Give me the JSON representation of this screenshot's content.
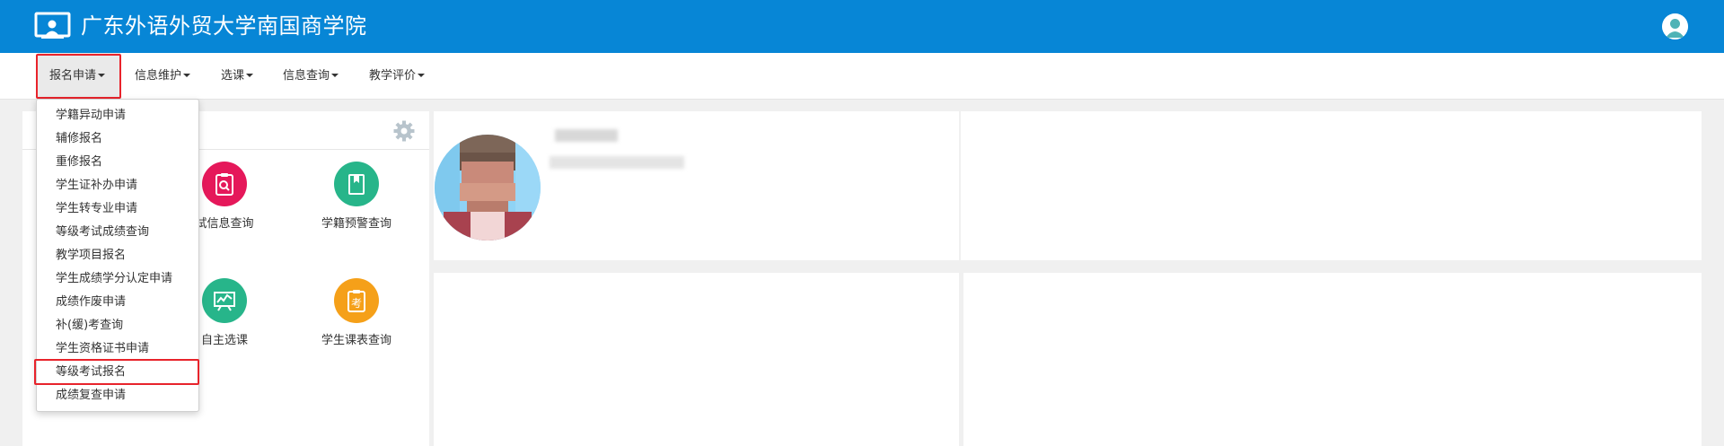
{
  "header": {
    "school_name": "广东外语外贸大学南国商学院",
    "logo_icon": "presentation-screen-icon",
    "avatar_icon": "user-avatar-icon",
    "background_color": "#0786d6"
  },
  "nav": {
    "items": [
      {
        "label": "报名申请",
        "active": true
      },
      {
        "label": "信息维护"
      },
      {
        "label": "选课"
      },
      {
        "label": "信息查询"
      },
      {
        "label": "教学评价"
      }
    ]
  },
  "dropdown": {
    "items": [
      "学籍异动申请",
      "辅修报名",
      "重修报名",
      "学生证补办申请",
      "学生转专业申请",
      "等级考试成绩查询",
      "教学项目报名",
      "学生成绩学分认定申请",
      "成绩作废申请",
      "补(缓)考查询",
      "学生资格证书申请",
      "等级考试报名",
      "成绩复查申请"
    ],
    "highlighted_item": "等级考试报名"
  },
  "apps": {
    "settings_icon": "gear-icon",
    "tiles": [
      {
        "label": "试信息查询",
        "icon": "clipboard-search-icon",
        "color": "#e5185a"
      },
      {
        "label": "学籍预警查询",
        "icon": "book-icon",
        "color": "#27b58a"
      },
      {
        "label": "自主选课",
        "icon": "chart-board-icon",
        "color": "#27b58a"
      },
      {
        "label": "学生课表查询",
        "icon": "exam-clipboard-icon",
        "color": "#f5a019"
      }
    ],
    "exam_glyph": "考"
  },
  "highlight_color": "#e8232b"
}
